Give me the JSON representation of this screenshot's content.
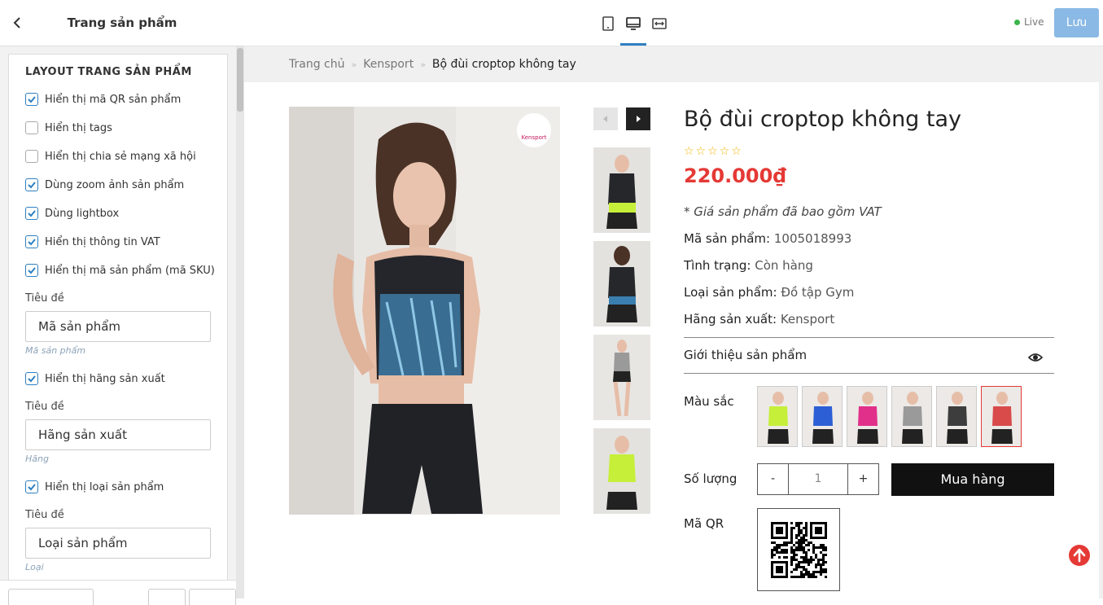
{
  "sidebar": {
    "title": "Trang sản phẩm",
    "section_title": "LAYOUT TRANG SẢN PHẨM",
    "options": [
      {
        "label": "Hiển thị mã QR sản phẩm",
        "checked": true
      },
      {
        "label": "Hiển thị tags",
        "checked": false
      },
      {
        "label": "Hiển thị chia sẻ mạng xã hội",
        "checked": false
      },
      {
        "label": "Dùng zoom ảnh sản phẩm",
        "checked": true
      },
      {
        "label": "Dùng lightbox",
        "checked": true
      },
      {
        "label": "Hiển thị thông tin VAT",
        "checked": true
      },
      {
        "label": "Hiển thị mã sản phẩm (mã SKU)",
        "checked": true
      }
    ],
    "sku_field": {
      "label": "Tiêu đề",
      "value": "Mã sản phẩm",
      "hint": "Mã sản phẩm"
    },
    "vendor_option": {
      "label": "Hiển thị hãng sản xuất",
      "checked": true
    },
    "vendor_field": {
      "label": "Tiêu đề",
      "value": "Hãng sản xuất",
      "hint": "Hãng"
    },
    "type_option": {
      "label": "Hiển thị loại sản phẩm",
      "checked": true
    },
    "type_field": {
      "label": "Tiêu đề",
      "value": "Loại sản phẩm",
      "hint": "Loại"
    }
  },
  "topbar": {
    "devices": [
      "mobile-icon",
      "desktop-icon",
      "fullwidth-icon"
    ],
    "active_device": "desktop-icon",
    "live_label": "Live",
    "save_label": "Lưu",
    "accent": "#2f7fc0"
  },
  "preview": {
    "breadcrumb": [
      "Trang chủ",
      "Kensport",
      "Bộ đùi croptop không tay"
    ],
    "logo_text": "Kensport",
    "product": {
      "title": "Bộ đùi croptop không tay",
      "rating": 0,
      "stars": "☆☆☆☆☆",
      "price": "220.000₫",
      "vat_note": "* Giá sản phẩm đã bao gồm VAT",
      "sku_label": "Mã sản phẩm:",
      "sku": "1005018993",
      "status_label": "Tình trạng:",
      "status": "Còn hàng",
      "type_label": "Loại sản phẩm:",
      "type": "Đồ tập Gym",
      "vendor_label": "Hãng sản xuất:",
      "vendor": "Kensport",
      "intro_label": "Giới thiệu sản phẩm",
      "color_label": "Màu sắc",
      "swatches": [
        "#c6ef3a",
        "#2c5fd6",
        "#e0308a",
        "#9a9a9a",
        "#3d3d3d",
        "#d94b4b"
      ],
      "selected_swatch": 5,
      "qty_label": "Số lượng",
      "qty_minus": "-",
      "qty_value": "1",
      "qty_plus": "+",
      "buy_label": "Mua hàng",
      "qr_label": "Mã QR",
      "price_color": "#e53935"
    },
    "thumbnails": [
      "#c6ef3a",
      "#3b7fb0",
      "#9a9a9a",
      "#c6ef3a"
    ]
  }
}
